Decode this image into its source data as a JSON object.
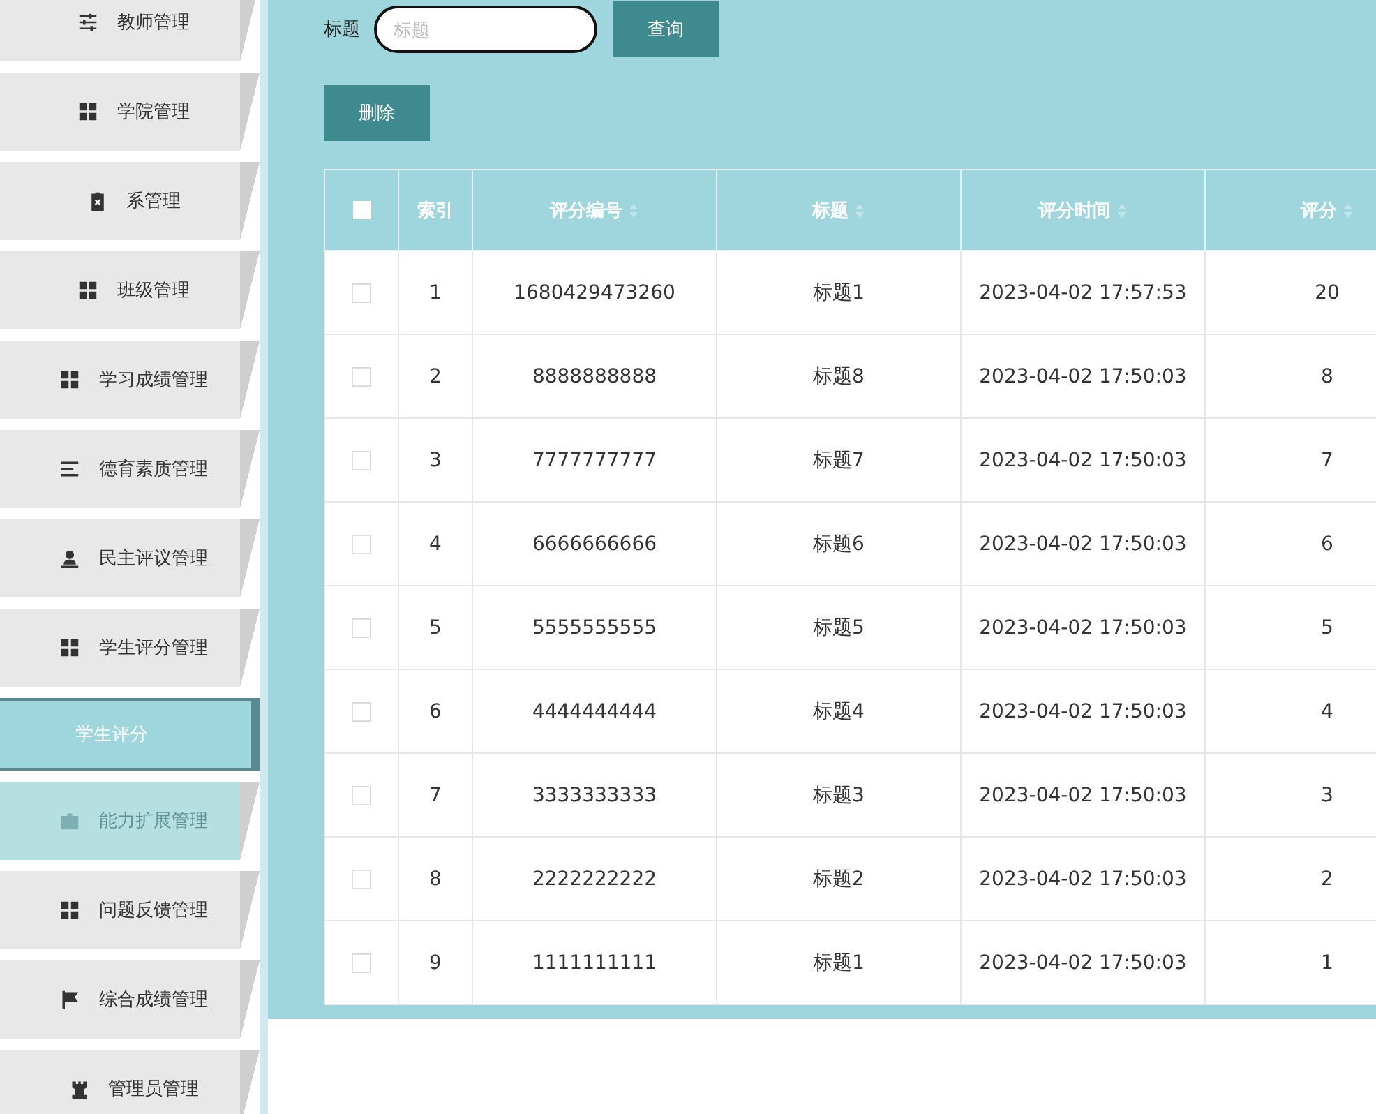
{
  "sidebar": {
    "items": [
      {
        "label": "教师管理",
        "kind": "sliders",
        "hovered": false
      },
      {
        "label": "学院管理",
        "kind": "grid",
        "hovered": false
      },
      {
        "label": "系管理",
        "kind": "clipboard",
        "hovered": false
      },
      {
        "label": "班级管理",
        "kind": "grid",
        "hovered": false
      },
      {
        "label": "学习成绩管理",
        "kind": "grid",
        "hovered": false
      },
      {
        "label": "德育素质管理",
        "kind": "list",
        "hovered": false
      },
      {
        "label": "民主评议管理",
        "kind": "person",
        "hovered": false
      },
      {
        "label": "学生评分管理",
        "kind": "grid",
        "hovered": false,
        "children": [
          {
            "label": "学生评分",
            "selected": true
          }
        ]
      },
      {
        "label": "能力扩展管理",
        "kind": "briefcase",
        "hovered": true
      },
      {
        "label": "问题反馈管理",
        "kind": "grid",
        "hovered": false
      },
      {
        "label": "综合成绩管理",
        "kind": "flag",
        "hovered": false
      },
      {
        "label": "管理员管理",
        "kind": "tower",
        "hovered": false
      }
    ]
  },
  "search": {
    "label": "标题",
    "placeholder": "标题",
    "button": "查询"
  },
  "actions": [
    "删除"
  ],
  "table": {
    "all_checked": false,
    "columns": [
      {
        "label": "索引",
        "sortable": false
      },
      {
        "label": "评分编号",
        "sortable": true
      },
      {
        "label": "标题",
        "sortable": true
      },
      {
        "label": "评分时间",
        "sortable": true
      },
      {
        "label": "评分",
        "sortable": true
      }
    ],
    "rows": [
      {
        "checked": false,
        "cells": [
          "1",
          "1680429473260",
          "标题1",
          "2023-04-02 17:57:53",
          "20"
        ]
      },
      {
        "checked": false,
        "cells": [
          "2",
          "8888888888",
          "标题8",
          "2023-04-02 17:50:03",
          "8"
        ]
      },
      {
        "checked": false,
        "cells": [
          "3",
          "7777777777",
          "标题7",
          "2023-04-02 17:50:03",
          "7"
        ]
      },
      {
        "checked": false,
        "cells": [
          "4",
          "6666666666",
          "标题6",
          "2023-04-02 17:50:03",
          "6"
        ]
      },
      {
        "checked": false,
        "cells": [
          "5",
          "5555555555",
          "标题5",
          "2023-04-02 17:50:03",
          "5"
        ]
      },
      {
        "checked": false,
        "cells": [
          "6",
          "4444444444",
          "标题4",
          "2023-04-02 17:50:03",
          "4"
        ]
      },
      {
        "checked": false,
        "cells": [
          "7",
          "3333333333",
          "标题3",
          "2023-04-02 17:50:03",
          "3"
        ]
      },
      {
        "checked": false,
        "cells": [
          "8",
          "2222222222",
          "标题2",
          "2023-04-02 17:50:03",
          "2"
        ]
      },
      {
        "checked": false,
        "cells": [
          "9",
          "1111111111",
          "标题1",
          "2023-04-02 17:50:03",
          "1"
        ]
      }
    ]
  }
}
